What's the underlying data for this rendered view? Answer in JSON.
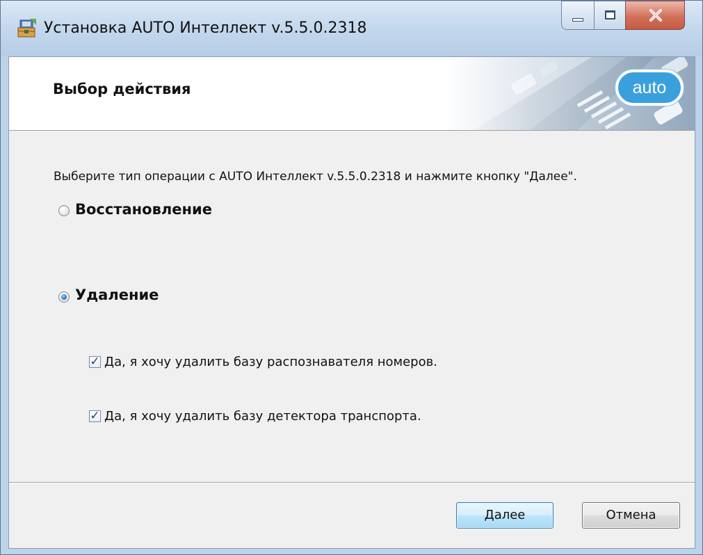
{
  "window": {
    "title": "Установка AUTO Интеллект v.5.5.0.2318"
  },
  "banner": {
    "title": "Выбор действия",
    "logo_text": "auto"
  },
  "main": {
    "instruction": "Выберите тип операции с AUTO Интеллект v.5.5.0.2318 и нажмите кнопку \"Далее\".",
    "options": [
      {
        "label": "Восстановление",
        "selected": false
      },
      {
        "label": "Удаление",
        "selected": true
      }
    ],
    "checkboxes": [
      {
        "label": "Да, я хочу удалить базу распознавателя номеров.",
        "checked": true
      },
      {
        "label": "Да, я хочу удалить базу детектора транспорта.",
        "checked": true
      }
    ]
  },
  "footer": {
    "next_label": "Далее",
    "cancel_label": "Отмена"
  },
  "colors": {
    "accent": "#3aa0dd",
    "window_frame": "#bcd3ea",
    "client_bg": "#f0f0f0"
  }
}
